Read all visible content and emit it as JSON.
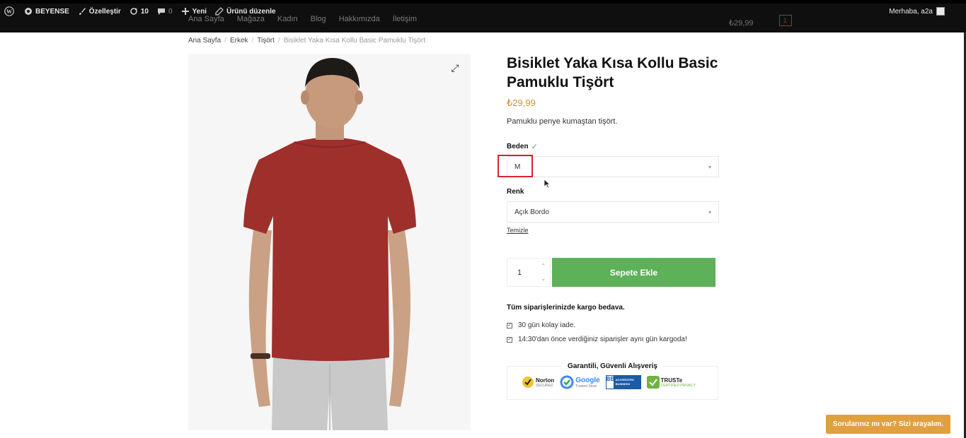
{
  "admin_bar": {
    "site_name": "BEYENSE",
    "customize": "Özelleştir",
    "updates_count": "10",
    "comments_count": "0",
    "new": "Yeni",
    "edit_product": "Ürünü düzenle",
    "greeting": "Merhaba, a2a"
  },
  "main_nav": {
    "items": [
      "Ana Sayfa",
      "Mağaza",
      "Kadın",
      "Blog",
      "Hakkımızda",
      "İletişim"
    ],
    "cart_total": "₺29,99",
    "cart_count": "1"
  },
  "breadcrumb": {
    "items": [
      "Ana Sayfa",
      "Erkek",
      "Tişört"
    ],
    "current": "Bisiklet Yaka Kısa Kollu Basic Pamuklu Tişört"
  },
  "product": {
    "title": "Bisiklet Yaka Kısa Kollu Basic Pamuklu Tişört",
    "price": "₺29,99",
    "short_description": "Pamuklu penye kumaştan tişört.",
    "shirt_color": "#9e2f2b"
  },
  "variations": {
    "size_label": "Beden",
    "size_value": "M",
    "color_label": "Renk",
    "color_value": "Açık Bordo",
    "clear_label": "Temizle"
  },
  "cart_form": {
    "quantity": "1",
    "add_to_cart": "Sepete Ekle",
    "button_color": "#5db159"
  },
  "info": {
    "shipping": "Tüm siparişlerinizde kargo bedava.",
    "features": [
      "30 gün kolay iade.",
      "14:30'dan önce verdiğiniz siparişler aynı gün kargoda!"
    ]
  },
  "trust": {
    "title": "Garantili, Güvenli Alışveriş",
    "badges": [
      "Norton",
      "Google",
      "BBB",
      "TRUSTe"
    ],
    "badge_subs": [
      "SECURED",
      "Trusted Store",
      "ACCREDITED BUSINESS",
      "CERTIFIED PRIVACY"
    ]
  },
  "help_button": "Sorularınız mı var? Sizi arayalım.",
  "accent_color": "#d0902b"
}
